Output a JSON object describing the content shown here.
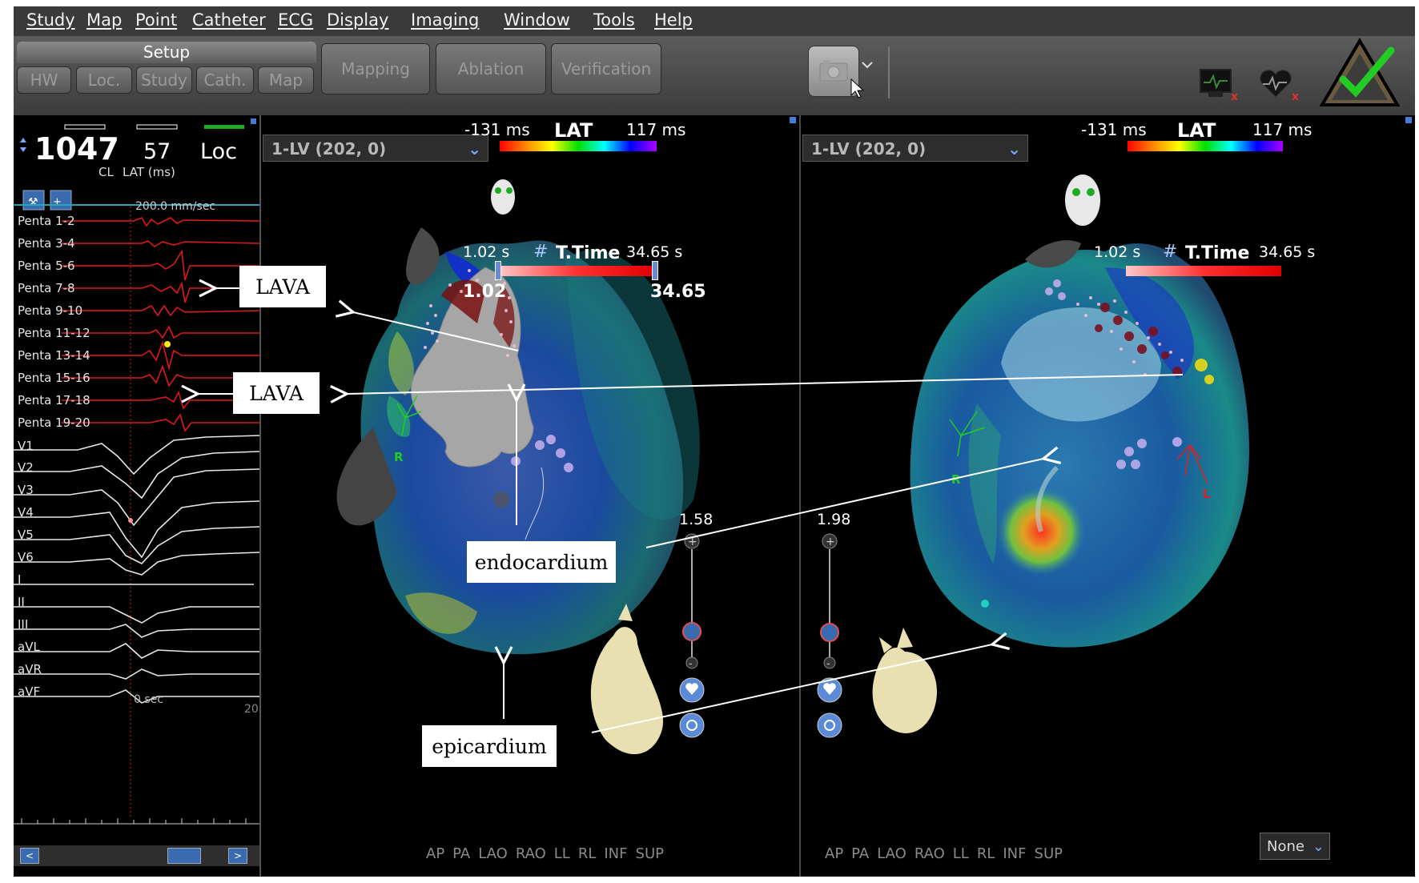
{
  "menu": [
    "Study",
    "Map",
    "Point",
    "Catheter",
    "ECG",
    "Display",
    "Imaging",
    "Window",
    "Tools",
    "Help"
  ],
  "toolbar": {
    "setup_label": "Setup",
    "setup_tabs": [
      "HW",
      "Loc.",
      "Study",
      "Cath.",
      "Map"
    ],
    "phases": [
      "Mapping",
      "Ablation",
      "Verification"
    ],
    "camera_icon": "camera-icon",
    "colors": {
      "menubar": "#3a3a3a",
      "toolbar": "#4a4a4a",
      "accept": "#22cc22"
    }
  },
  "ecg_panel": {
    "cl_value": "1047",
    "cl_label": "CL",
    "lat_value": "57",
    "lat_label": "LAT (ms)",
    "loc_label": "Loc",
    "speed": "200.0 mm/sec",
    "time_label": "0 sec",
    "time_end": "20",
    "leads_red": [
      "Penta 1-2",
      "Penta 3-4",
      "Penta 5-6",
      "Penta 7-8",
      "Penta 9-10",
      "Penta 11-12",
      "Penta 13-14",
      "Penta 15-16",
      "Penta 17-18",
      "Penta 19-20"
    ],
    "leads_white": [
      "V1",
      "V2",
      "V3",
      "V4",
      "V5",
      "V6",
      "I",
      "II",
      "III",
      "aVL",
      "aVR",
      "aVF"
    ]
  },
  "viewport_left": {
    "map_select": "1-LV (202, 0)",
    "lat_min": "-131 ms",
    "lat_title": "LAT",
    "lat_max": "117 ms",
    "ttime_start": "1.02 s",
    "ttime_title": "T.Time",
    "ttime_end": "34.65 s",
    "slider_start_value": "1.02",
    "slider_end_value": "34.65",
    "zoom_value": "1.58",
    "marker_r": "R"
  },
  "viewport_right": {
    "map_select": "1-LV (202, 0)",
    "lat_min": "-131 ms",
    "lat_title": "LAT",
    "lat_max": "117 ms",
    "ttime_start": "1.02 s",
    "ttime_title": "T.Time",
    "ttime_end": "34.65 s",
    "zoom_value": "1.98",
    "marker_r": "R",
    "marker_l": "L",
    "none_select": "None"
  },
  "views": [
    "AP",
    "PA",
    "LAO",
    "RAO",
    "LL",
    "RL",
    "INF",
    "SUP"
  ],
  "annotations": {
    "lava_1": "LAVA",
    "lava_2": "LAVA",
    "endocardium": "endocardium",
    "epicardium": "epicardium"
  }
}
